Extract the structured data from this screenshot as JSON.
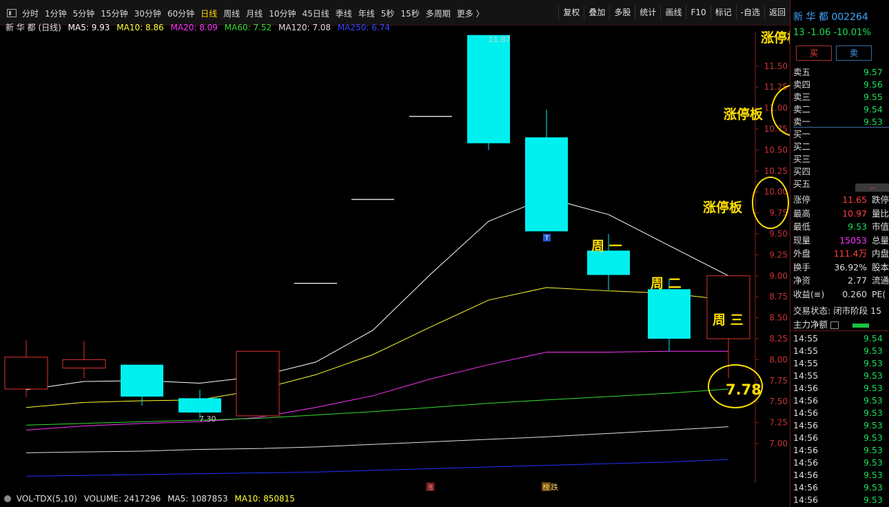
{
  "toolbar": {
    "periods": [
      "分时",
      "1分钟",
      "5分钟",
      "15分钟",
      "30分钟",
      "60分钟",
      "日线",
      "周线",
      "月线",
      "10分钟",
      "45日线",
      "季线",
      "年线",
      "5秒",
      "15秒",
      "多周期",
      "更多 〉"
    ],
    "active_period": "日线",
    "tools": [
      "复权",
      "叠加",
      "多股",
      "统计",
      "画线",
      "F10",
      "标记",
      "-自选",
      "返回"
    ]
  },
  "legend": {
    "name": "新 华 都 (日线)",
    "ma5": "MA5: 9.93",
    "ma10": "MA10: 8.86",
    "ma20": "MA20: 8.09",
    "ma60": "MA60: 7.52",
    "ma120": "MA120: 7.08",
    "ma250": "MA250: 6.74"
  },
  "axis": {
    "ticks": [
      "11.50",
      "11.25",
      "11.00",
      "10.75",
      "10.50",
      "10.25",
      "10.00",
      "9.75",
      "9.50",
      "9.25",
      "9.00",
      "8.75",
      "8.50",
      "8.25",
      "8.00",
      "7.75",
      "7.50",
      "7.25",
      "7.00"
    ],
    "vol_tick": "30000"
  },
  "price_labels": {
    "high": "11.87",
    "low": "7.30"
  },
  "markers": {
    "zhang": "涨",
    "bang": "榜",
    "die": "跌",
    "t": "T"
  },
  "annotations": {
    "limit1": "涨停板",
    "limit2": "涨停板",
    "limit3": "涨停板",
    "mon": "周 一",
    "tue": "周 二",
    "wed": "周 三",
    "target": "7.78"
  },
  "chart_data": {
    "type": "candlestick",
    "price_range": [
      7.0,
      11.9
    ],
    "candles": [
      {
        "o": 7.65,
        "h": 8.23,
        "l": 7.55,
        "c": 8.03,
        "up": true
      },
      {
        "o": 7.9,
        "h": 8.22,
        "l": 7.78,
        "c": 8.0,
        "up": true
      },
      {
        "o": 7.94,
        "h": 7.94,
        "l": 7.45,
        "c": 7.56,
        "up": false
      },
      {
        "o": 7.54,
        "h": 7.64,
        "l": 7.3,
        "c": 7.37,
        "up": false
      },
      {
        "o": 7.33,
        "h": 8.1,
        "l": 7.33,
        "c": 8.1,
        "up": true
      },
      {
        "o": 8.91,
        "h": 8.91,
        "l": 8.91,
        "c": 8.91,
        "up": true
      },
      {
        "o": 9.91,
        "h": 9.91,
        "l": 9.91,
        "c": 9.91,
        "up": true
      },
      {
        "o": 10.9,
        "h": 10.9,
        "l": 10.9,
        "c": 10.9,
        "up": true
      },
      {
        "o": 11.87,
        "h": 11.87,
        "l": 10.5,
        "c": 10.58,
        "up": false
      },
      {
        "o": 10.65,
        "h": 10.98,
        "l": 9.58,
        "c": 9.53,
        "up": false
      },
      {
        "o": 9.3,
        "h": 9.5,
        "l": 8.83,
        "c": 9.01,
        "up": false
      },
      {
        "o": 8.84,
        "h": 8.97,
        "l": 8.1,
        "c": 8.25,
        "up": false
      },
      {
        "o": 8.25,
        "h": 9.0,
        "l": 7.78,
        "c": 9.0,
        "up": true
      }
    ],
    "series": [
      {
        "name": "MA5",
        "color": "#ffffff",
        "values": [
          7.64,
          7.74,
          7.75,
          7.72,
          7.8,
          7.97,
          8.35,
          9.02,
          9.65,
          9.93,
          9.73,
          9.36,
          9.0
        ]
      },
      {
        "name": "MA10",
        "color": "#ffff33",
        "values": [
          7.43,
          7.49,
          7.51,
          7.52,
          7.64,
          7.82,
          8.06,
          8.39,
          8.71,
          8.86,
          8.82,
          8.79,
          8.71
        ]
      },
      {
        "name": "MA20",
        "color": "#ff33ff",
        "values": [
          7.16,
          7.21,
          7.24,
          7.26,
          7.31,
          7.43,
          7.57,
          7.77,
          7.94,
          8.09,
          8.09,
          8.1,
          8.1
        ]
      },
      {
        "name": "MA60",
        "color": "#33dd33",
        "values": [
          7.22,
          7.24,
          7.26,
          7.28,
          7.3,
          7.34,
          7.38,
          7.43,
          7.48,
          7.52,
          7.56,
          7.6,
          7.65
        ]
      },
      {
        "name": "MA120",
        "color": "#e0e0e0",
        "values": [
          6.89,
          6.9,
          6.91,
          6.93,
          6.94,
          6.96,
          6.99,
          7.02,
          7.05,
          7.08,
          7.12,
          7.16,
          7.2
        ]
      },
      {
        "name": "MA250",
        "color": "#2233ff",
        "values": [
          6.61,
          6.62,
          6.63,
          6.64,
          6.65,
          6.66,
          6.68,
          6.7,
          6.72,
          6.74,
          6.76,
          6.78,
          6.81
        ]
      }
    ]
  },
  "volume": {
    "name": "VOL-TDX(5,10)",
    "volume": "VOLUME: 2417296",
    "ma5": "MA5: 1087853",
    "ma10": "MA10: 850815"
  },
  "quote": {
    "title": "新 华 都 002264",
    "price_line": "13 -1.06 -10.01%",
    "buy": "买",
    "sell": "卖",
    "asks": [
      {
        "label": "卖五",
        "price": "9.57"
      },
      {
        "label": "卖四",
        "price": "9.56"
      },
      {
        "label": "卖三",
        "price": "9.55"
      },
      {
        "label": "卖二",
        "price": "9.54"
      },
      {
        "label": "卖一",
        "price": "9.53"
      }
    ],
    "bids": [
      {
        "label": "买一"
      },
      {
        "label": "买二"
      },
      {
        "label": "买三"
      },
      {
        "label": "买四"
      },
      {
        "label": "买五"
      }
    ],
    "stats": [
      {
        "label": "涨停",
        "value": "11.65",
        "right": "跌停",
        "color": "#ff4040"
      },
      {
        "label": "最高",
        "value": "10.97",
        "right": "量比",
        "color": "#ff4040"
      },
      {
        "label": "最低",
        "value": "9.53",
        "right": "市值",
        "color": "#19e05a"
      },
      {
        "label": "现量",
        "value": "15053",
        "right": "总量",
        "color": "#ff33ff"
      },
      {
        "label": "外盘",
        "value": "111.4万",
        "right": "内盘",
        "color": "#ff4040"
      },
      {
        "label": "换手",
        "value": "36.92%",
        "right": "股本",
        "color": "#dddddd"
      },
      {
        "label": "净资",
        "value": "2.77",
        "right": "流通",
        "color": "#dddddd"
      },
      {
        "label": "收益(≡)",
        "value": "0.260",
        "right": "PE(",
        "color": "#dddddd"
      }
    ],
    "state": "交易状态: 闭市阶段 15",
    "net_flow": "主力净额",
    "trades": [
      {
        "t": "14:55",
        "p": "9.54"
      },
      {
        "t": "14:55",
        "p": "9.53"
      },
      {
        "t": "14:55",
        "p": "9.53"
      },
      {
        "t": "14:55",
        "p": "9.53"
      },
      {
        "t": "14:56",
        "p": "9.53"
      },
      {
        "t": "14:56",
        "p": "9.53"
      },
      {
        "t": "14:56",
        "p": "9.53"
      },
      {
        "t": "14:56",
        "p": "9.53"
      },
      {
        "t": "14:56",
        "p": "9.53"
      },
      {
        "t": "14:56",
        "p": "9.53"
      },
      {
        "t": "14:56",
        "p": "9.53"
      },
      {
        "t": "14:56",
        "p": "9.53"
      },
      {
        "t": "14:56",
        "p": "9.53"
      },
      {
        "t": "14:56",
        "p": "9.53"
      }
    ]
  }
}
